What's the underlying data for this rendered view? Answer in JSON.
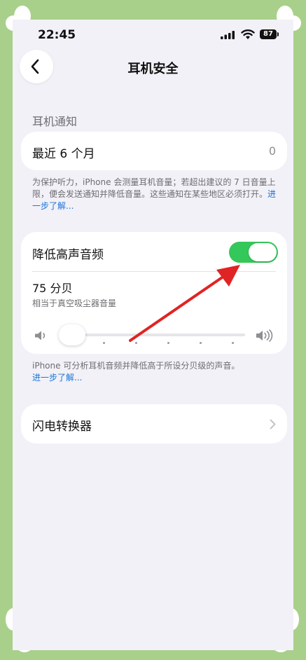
{
  "status_bar": {
    "time": "22:45",
    "battery": "87"
  },
  "nav": {
    "title": "耳机安全"
  },
  "notifications": {
    "header": "耳机通知",
    "row_label": "最近 6 个月",
    "row_value": "0",
    "footnote": "为保护听力，iPhone 会测量耳机音量；若超出建议的 7 日音量上限，便会发送通知并降低音量。这些通知在某些地区必须打开。",
    "footnote_link": "进一步了解..."
  },
  "reduce_loud": {
    "label": "降低高声音频",
    "toggle_on": true,
    "level": "75 分贝",
    "level_desc": "相当于真空吸尘器音量",
    "slider_fraction": 0.0,
    "footnote": "iPhone 可分析耳机音频并降低高于所设分贝级的声音。",
    "footnote_link": "进一步了解..."
  },
  "lightning": {
    "label": "闪电转换器"
  },
  "colors": {
    "accent": "#34c759",
    "link": "#1a73d9",
    "annotation_arrow": "#e02424"
  },
  "icons": [
    "back-chevron-icon",
    "signal-icon",
    "wifi-icon",
    "battery-icon",
    "volume-low-icon",
    "volume-high-icon",
    "chevron-right-icon"
  ]
}
